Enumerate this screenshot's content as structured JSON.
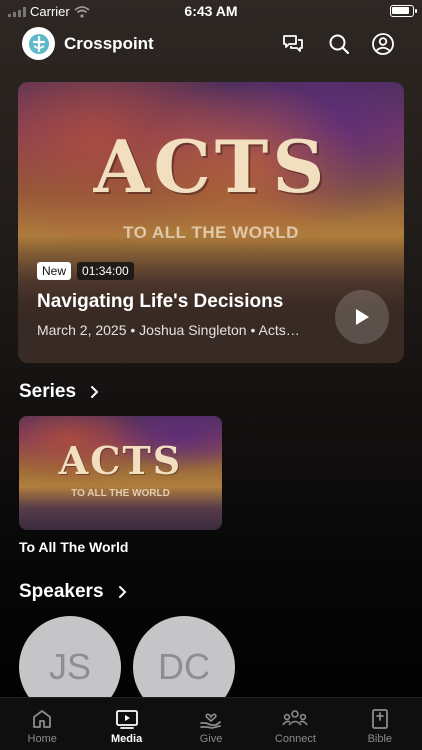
{
  "status_bar": {
    "carrier": "Carrier",
    "time": "6:43 AM",
    "battery_level": 0.9
  },
  "header": {
    "app_name": "Crosspoint",
    "logo_icon": "crosspoint-logo-icon",
    "icons": [
      "chat-icon",
      "search-icon",
      "profile-icon"
    ]
  },
  "hero": {
    "art_title": "ACTS",
    "art_subtitle": "TO ALL THE WORLD",
    "badge": "New",
    "duration": "01:34:00",
    "title": "Navigating Life's Decisions",
    "meta": "March 2, 2025 • Joshua Singleton • Acts…",
    "play_icon": "play-icon"
  },
  "series": {
    "heading": "Series",
    "items": [
      {
        "art_title": "ACTS",
        "art_subtitle": "TO ALL THE WORLD",
        "caption": "To All The World"
      }
    ]
  },
  "speakers": {
    "heading": "Speakers",
    "items": [
      {
        "initials": "JS"
      },
      {
        "initials": "DC"
      }
    ]
  },
  "tabs": [
    {
      "label": "Home",
      "icon": "home-icon",
      "active": false
    },
    {
      "label": "Media",
      "icon": "media-icon",
      "active": true
    },
    {
      "label": "Give",
      "icon": "give-icon",
      "active": false
    },
    {
      "label": "Connect",
      "icon": "connect-icon",
      "active": false
    },
    {
      "label": "Bible",
      "icon": "bible-icon",
      "active": false
    }
  ],
  "colors": {
    "accent": "#ffffff",
    "art_text": "#f1dfc0",
    "avatar_bg": "#c5c5c8",
    "avatar_text": "#8d8d92",
    "tab_inactive": "#8b8b8b"
  }
}
